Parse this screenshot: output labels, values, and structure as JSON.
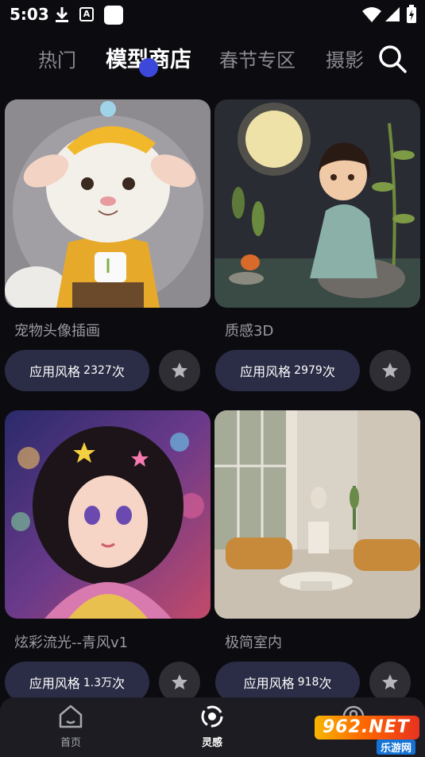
{
  "status_bar": {
    "time": "5:03"
  },
  "tabs": [
    {
      "label": "热门"
    },
    {
      "label": "模型商店"
    },
    {
      "label": "春节专区"
    },
    {
      "label": "摄影"
    }
  ],
  "cards": [
    {
      "title": "宠物头像插画",
      "apply_label": "应用风格",
      "count": "2327",
      "count_suffix": "次"
    },
    {
      "title": "质感3D",
      "apply_label": "应用风格",
      "count": "2979",
      "count_suffix": "次"
    },
    {
      "title": "炫彩流光--青风v1",
      "apply_label": "应用风格",
      "count": "1.3万",
      "count_suffix": "次"
    },
    {
      "title": "极简室内",
      "apply_label": "应用风格",
      "count": "918",
      "count_suffix": "次"
    }
  ],
  "bottom_nav": [
    {
      "label": "首页"
    },
    {
      "label": "灵感"
    }
  ],
  "watermark": {
    "logo": "962.NET",
    "sub": "乐游网"
  },
  "colors": {
    "background": "#0b0b10",
    "accent": "#3c48d9",
    "button": "#2b2c45"
  }
}
